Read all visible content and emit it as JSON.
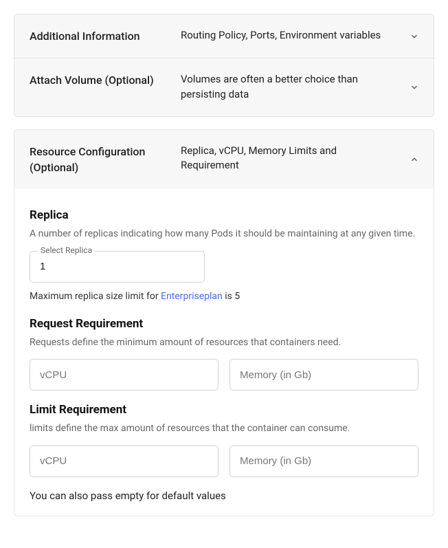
{
  "accordion": {
    "additional": {
      "title": "Additional Information",
      "desc": "Routing Policy, Ports, Environment variables"
    },
    "volume": {
      "title": "Attach Volume (Optional)",
      "desc": "Volumes are often a better choice than persisting data"
    },
    "resource": {
      "title": "Resource Configuration (Optional)",
      "desc": "Replica, vCPU, Memory Limits and Requirement"
    }
  },
  "replica": {
    "heading": "Replica",
    "sub": "A number of replicas indicating how many Pods it should be maintaining at any given time.",
    "float_label": "Select Replica",
    "value": "1",
    "hint_prefix": "Maximum replica size limit for ",
    "hint_link": "Enterpriseplan",
    "hint_suffix": " is 5"
  },
  "request": {
    "heading": "Request Requirement",
    "sub": "Requests define the minimum amount of resources that containers need.",
    "vcpu_placeholder": "vCPU",
    "mem_placeholder": "Memory (in Gb)"
  },
  "limit": {
    "heading": "Limit Requirement",
    "sub": "limits define the max amount of resources that the container can consume.",
    "vcpu_placeholder": "vCPU",
    "mem_placeholder": "Memory (in Gb)"
  },
  "footer_note": "You can also pass empty for default values"
}
